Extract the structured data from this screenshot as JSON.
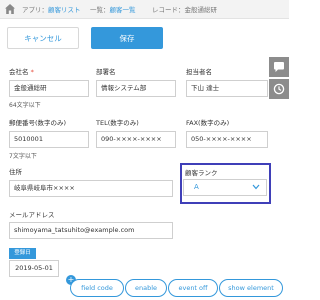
{
  "breadcrumb": {
    "app_prefix": "アプリ：",
    "app_name": "顧客リスト",
    "list_prefix": "一覧：",
    "list_name": "顧客一覧",
    "record_prefix": "レコード：",
    "record_name": "金般通総研"
  },
  "toolbar": {
    "cancel_label": "キャンセル",
    "save_label": "保存"
  },
  "form": {
    "company": {
      "label": "会社名",
      "required_mark": "*",
      "value": "金般通総研",
      "note": "64文字以下"
    },
    "department": {
      "label": "部署名",
      "value": "情報システム部"
    },
    "contact": {
      "label": "担当者名",
      "value": "下山 達士"
    },
    "postal": {
      "label": "郵便番号(数字のみ)",
      "value": "5010001",
      "note": "7文字以下"
    },
    "tel": {
      "label": "TEL(数字のみ)",
      "value": "090-××××-××××"
    },
    "fax": {
      "label": "FAX(数字のみ)",
      "value": "050-××××-××××"
    },
    "address": {
      "label": "住所",
      "value": "岐阜県岐阜市××××"
    },
    "rank": {
      "label": "顧客ランク",
      "value": "A"
    },
    "email": {
      "label": "メールアドレス",
      "value": "shimoyama_tatsuhito@example.com"
    },
    "date": {
      "label": "登録日",
      "value": "2019-05-01"
    }
  },
  "tools": {
    "plus": "+",
    "field_code": "field code",
    "enable": "enable",
    "event_off": "event off",
    "show_element": "show element"
  },
  "colors": {
    "accent": "#3498db",
    "highlight": "#3f3fb8",
    "side_tab": "#8c8c8c",
    "required": "#e74c3c"
  }
}
